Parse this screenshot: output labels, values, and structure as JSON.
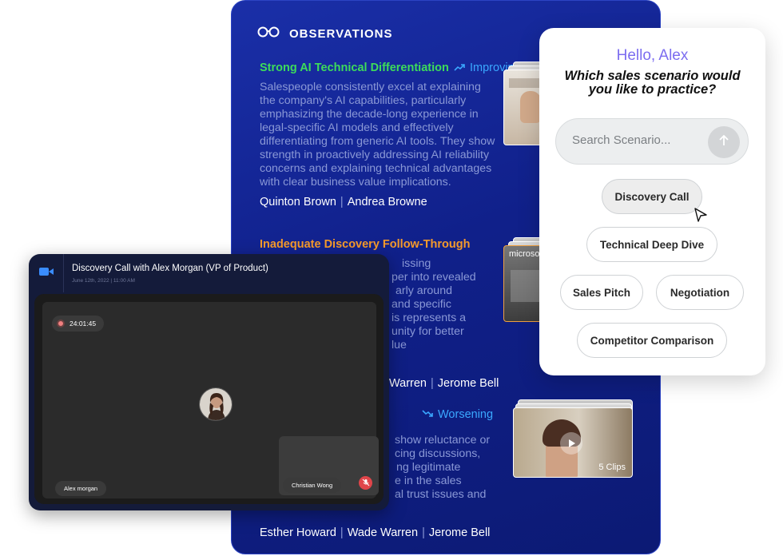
{
  "observations": {
    "title": "OBSERVATIONS",
    "items": [
      {
        "title": "Strong AI Technical Differentiation",
        "title_color": "#3ddc5a",
        "trend": "Improving",
        "trend_color": "#3aa8ff",
        "description": "Salespeople consistently excel at explaining the company's AI capabilities, particularly emphasizing the decade-long experience in legal-specific AI models and effectively differentiating from generic AI tools. They show strength in proactively addressing AI reliability concerns and explaining technical advantages with clear business value implications.",
        "people": [
          "Quinton Brown",
          "Andrea Browne"
        ]
      },
      {
        "title": "Inadequate Discovery Follow-Through",
        "title_color": "#f59a2b",
        "description": "issing per into revealed arly around and specific is represents a unity for better lue",
        "desc_lines": [
          "issing",
          "per into revealed",
          "arly around",
          "and specific",
          "is represents a",
          "unity for better",
          "lue"
        ],
        "people": [
          "Warren",
          "Jerome Bell"
        ]
      },
      {
        "trend": "Worsening",
        "trend_color": "#3aa8ff",
        "desc_lines": [
          "show reluctance or",
          "cing discussions,",
          "ng legitimate",
          "e in the sales",
          "al trust issues and"
        ],
        "people": [
          "Esther Howard",
          "Wade Warren",
          "Jerome Bell"
        ]
      }
    ],
    "thumbs": {
      "second_label": "microsoft",
      "third_label": "5 Clips"
    }
  },
  "scenario": {
    "greeting": "Hello, Alex",
    "question": "Which sales scenario would you like to practice?",
    "search_placeholder": "Search Scenario...",
    "chips": {
      "discovery": "Discovery Call",
      "technical": "Technical Deep Dive",
      "pitch": "Sales Pitch",
      "negotiation": "Negotiation",
      "competitor": "Competitor Comparison"
    }
  },
  "call": {
    "title": "Discovery Call with Alex Morgan (VP of Product)",
    "date": "June 12th, 2022 | 11:00 AM",
    "timer": "24:01:45",
    "main_participant": "Alex morgan",
    "pip_participant": "Christian Wong"
  },
  "colors": {
    "panel": "#10208a",
    "accent_purple": "#7c6df0",
    "mute_red": "#e0454a"
  }
}
